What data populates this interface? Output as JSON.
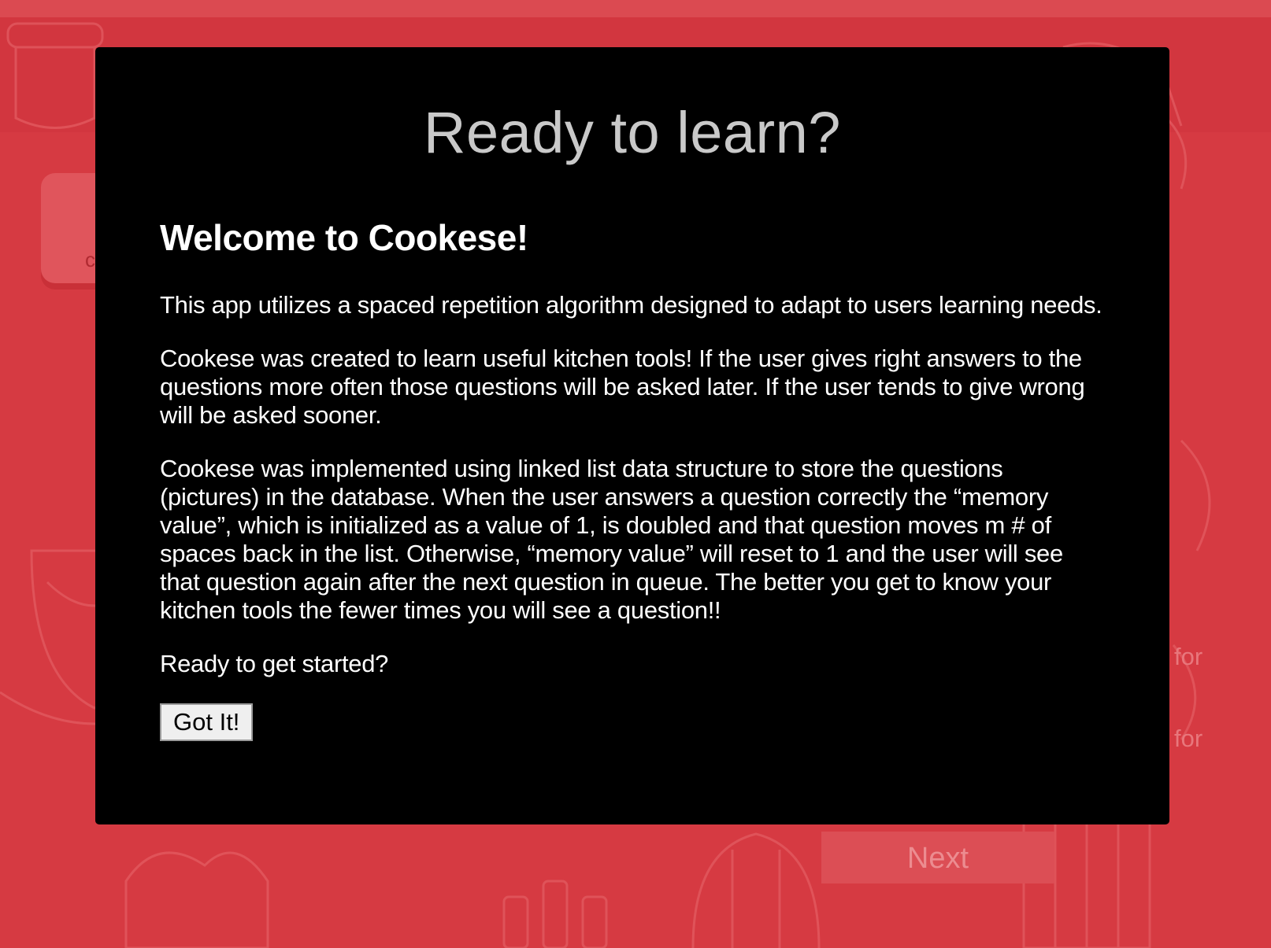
{
  "background": {
    "card_letter": "c",
    "for_label_1": "for",
    "for_label_2": "for",
    "next_button": "Next"
  },
  "modal": {
    "title": "Ready to learn?",
    "heading": "Welcome to Cookese!",
    "paragraph_1": "This app utilizes a spaced repetition algorithm designed to adapt to users learning needs.",
    "paragraph_2": "Cookese was created to learn useful kitchen tools! If the user gives right answers to the questions more often those questions will be asked later. If the user tends to give wrong will be asked sooner.",
    "paragraph_3": "Cookese was implemented using linked list data structure to store the questions (pictures) in the database. When the user answers a question correctly the “memory value”, which is initialized as a value of 1, is doubled and that question moves m # of spaces back in the list. Otherwise, “memory value” will reset to 1 and the user will see that question again after the next question in queue. The better you get to know your kitchen tools the fewer times you will see a question!!",
    "paragraph_4": "Ready to get started?",
    "button_label": "Got It!"
  },
  "colors": {
    "background": "#d63a42",
    "modal": "#000000",
    "title": "#c9c9c9",
    "button": "#efefef"
  }
}
